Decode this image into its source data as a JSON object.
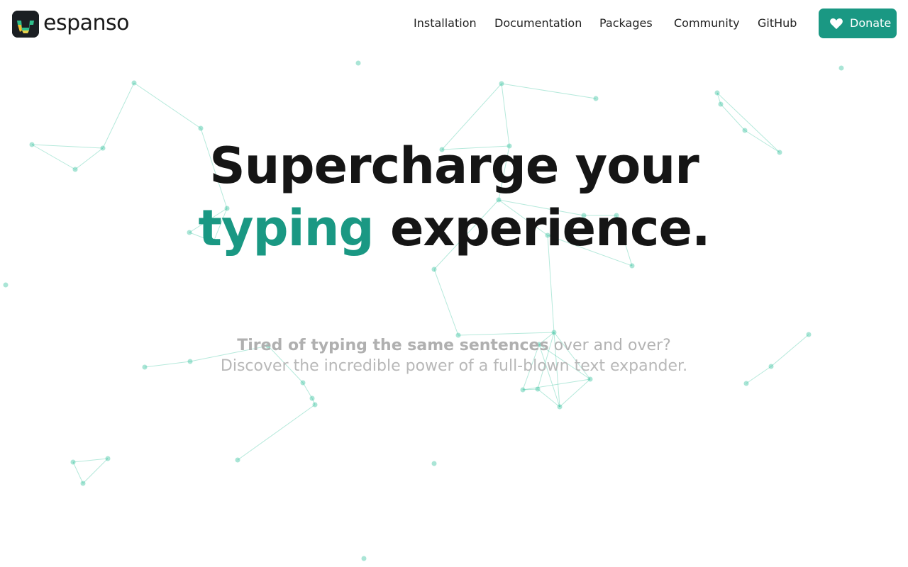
{
  "brand": {
    "name": "espanso",
    "icon": "espanso-logo-icon"
  },
  "nav": {
    "links": [
      "Installation",
      "Documentation",
      "Packages",
      "Community",
      "GitHub"
    ],
    "donate": {
      "label": "Donate",
      "icon": "heart-icon"
    }
  },
  "hero": {
    "line1": "Supercharge your",
    "accent_word": "typing",
    "line2_rest": " experience.",
    "sub_bold": "Tired of typing the same sentences",
    "sub_rest": " over and over?",
    "sub_line2": "Discover the incredible power of a full-blown text expander."
  },
  "colors": {
    "accent": "#1a9883",
    "heading": "#151515",
    "subtext": "#b3b3b3",
    "network": "#2bbf99"
  }
}
